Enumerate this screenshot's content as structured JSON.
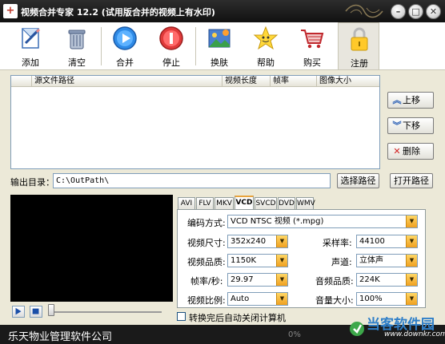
{
  "window": {
    "title": "视频合并专家 12.2 (试用版合并的视频上有水印)",
    "controls": {
      "minimize": "–",
      "maximize": "□",
      "close": "✕"
    }
  },
  "toolbar": {
    "items": [
      {
        "label": "添加",
        "icon": "add-file-icon"
      },
      {
        "label": "清空",
        "icon": "clear-bin-icon"
      },
      {
        "label": "合并",
        "icon": "merge-play-icon"
      },
      {
        "label": "停止",
        "icon": "stop-icon"
      },
      {
        "label": "换肤",
        "icon": "skin-icon"
      },
      {
        "label": "帮助",
        "icon": "help-star-icon"
      },
      {
        "label": "购买",
        "icon": "buy-cart-icon"
      },
      {
        "label": "注册",
        "icon": "register-lock-icon"
      }
    ]
  },
  "file_list": {
    "columns": [
      "源文件路径",
      "视频长度",
      "帧率",
      "图像大小"
    ],
    "rows": []
  },
  "side_buttons": {
    "move_up": "上移",
    "move_down": "下移",
    "delete": "删除"
  },
  "output": {
    "label": "输出目录：",
    "path": "C:\\OutPath\\",
    "choose_button": "选择路径",
    "open_button": "打开路径"
  },
  "tabs": [
    "AVI",
    "FLV",
    "MKV",
    "VCD",
    "SVCD",
    "DVD",
    "WMV"
  ],
  "selected_tab": "VCD",
  "settings": {
    "encoding": {
      "label": "编码方式:",
      "value": "VCD NTSC 视频 (*.mpg)"
    },
    "video_size": {
      "label": "视频尺寸:",
      "value": "352x240"
    },
    "sample_rate": {
      "label": "采样率:",
      "value": "44100"
    },
    "video_quality": {
      "label": "视频品质:",
      "value": "1150K"
    },
    "channel": {
      "label": "声道:",
      "value": "立体声"
    },
    "frame_rate": {
      "label": "帧率/秒:",
      "value": "29.97"
    },
    "audio_quality": {
      "label": "音频品质:",
      "value": "224K"
    },
    "aspect_ratio": {
      "label": "视频比例:",
      "value": "Auto"
    },
    "volume": {
      "label": "音量大小:",
      "value": "100%"
    }
  },
  "shutdown_option": {
    "label": "转换完后自动关闭计算机",
    "checked": false
  },
  "footer": {
    "company": "乐天物业管理软件公司",
    "progress": "0%"
  },
  "watermark": {
    "name": "当客软件园",
    "url": "www.downkr.com"
  },
  "colors": {
    "titlebar": "#1a1a1a",
    "panel": "#ece9d8",
    "combo_arrow": "#f0a020",
    "tab_selected_border": "#e8a33d",
    "site_logo": "#2f7fc8"
  }
}
